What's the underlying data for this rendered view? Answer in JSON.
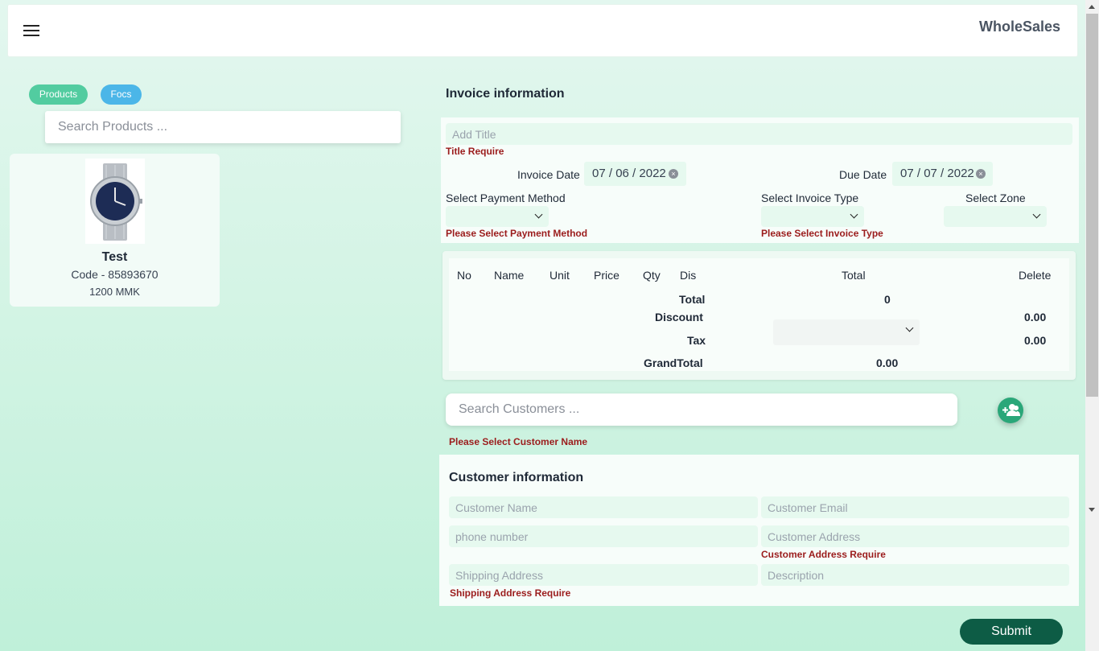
{
  "header": {
    "brand": "WholeSales",
    "menu_icon": "hamburger-menu-icon"
  },
  "left": {
    "tabs": [
      {
        "label": "Products",
        "color": "#52cca0"
      },
      {
        "label": "Focs",
        "color": "#4bb6e8"
      }
    ],
    "search_placeholder": "Search Products ...",
    "product": {
      "name": "Test",
      "code": "Code - 85893670",
      "price": "1200 MMK",
      "image_icon": "watch-image"
    }
  },
  "invoice": {
    "title": "Invoice information",
    "title_placeholder": "Add Title",
    "title_error": "Title Require",
    "invoice_date_label": "Invoice Date",
    "invoice_date": {
      "mm": "07",
      "dd": "06",
      "yyyy": "2022"
    },
    "due_date_label": "Due Date",
    "due_date": {
      "mm": "07",
      "dd": "07",
      "yyyy": "2022"
    },
    "payment_label": "Select Payment Method",
    "payment_error": "Please Select Payment Method",
    "type_label": "Select Invoice Type",
    "type_error": "Please Select Invoice Type",
    "zone_label": "Select Zone"
  },
  "table": {
    "columns": [
      "No",
      "Name",
      "Unit",
      "Price",
      "Qty",
      "Dis",
      "Total",
      "Delete"
    ],
    "total_label": "Total",
    "total_value": "0",
    "discount_label": "Discount",
    "discount_value": "0.00",
    "tax_label": "Tax",
    "tax_value": "0.00",
    "grand_label": "GrandTotal",
    "grand_value": "0.00"
  },
  "customer_search": {
    "placeholder": "Search Customers ...",
    "error": "Please Select Customer Name",
    "add_icon": "add-user-icon"
  },
  "customer": {
    "title": "Customer information",
    "name_placeholder": "Customer Name",
    "email_placeholder": "Customer Email",
    "phone_placeholder": "phone number",
    "address_placeholder": "Customer Address",
    "address_error": "Customer Address Require",
    "shipping_placeholder": "Shipping Address",
    "shipping_error": "Shipping Address Require",
    "description_placeholder": "Description"
  },
  "submit_label": "Submit",
  "colors": {
    "accent": "#0d5c45",
    "error": "#9b1c1c",
    "field_bg": "#e6f9ef"
  }
}
